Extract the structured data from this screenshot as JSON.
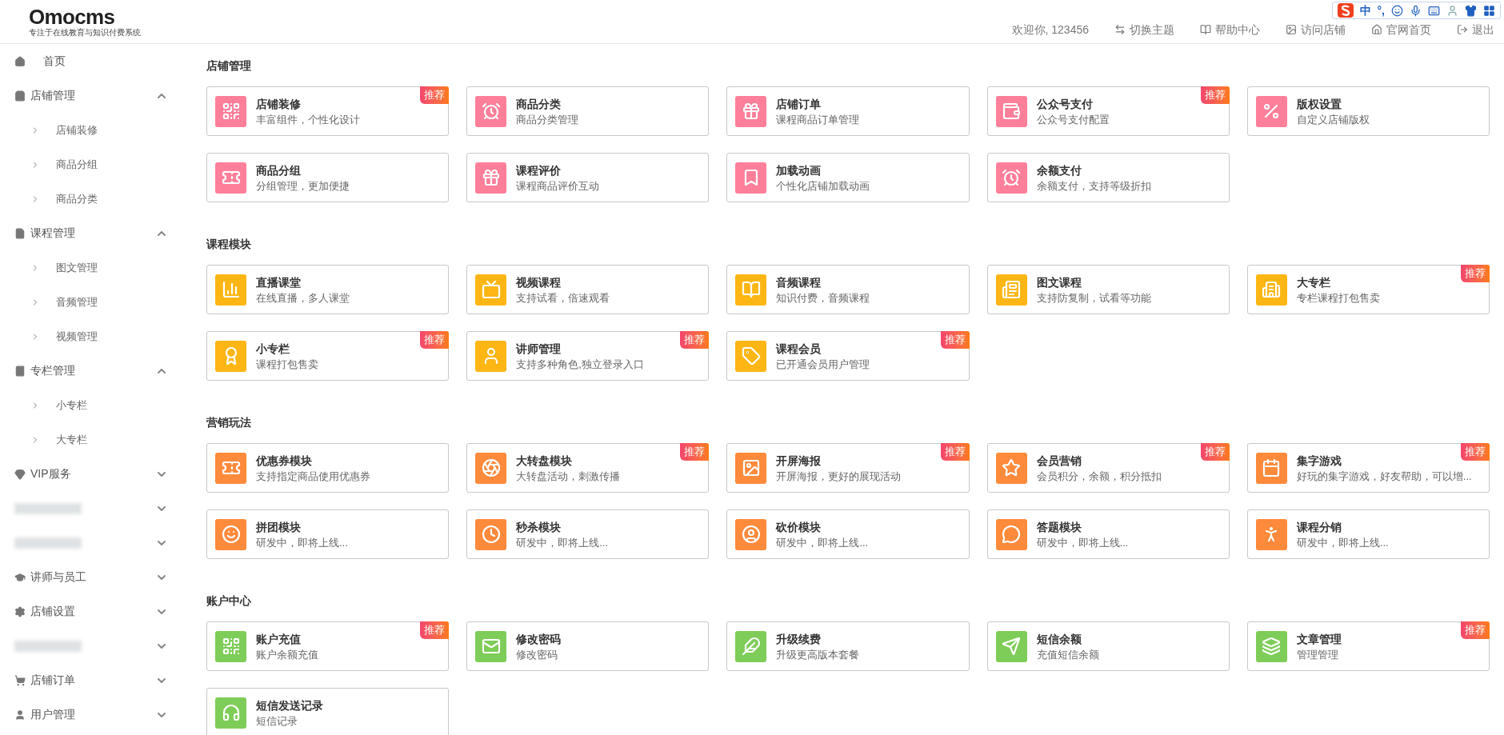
{
  "header": {
    "logo": "Omocms",
    "tagline": "专注于在线教育与知识付费系统",
    "welcome": "欢迎你, 123456",
    "links": [
      {
        "label": "切换主题"
      },
      {
        "label": "帮助中心"
      },
      {
        "label": "访问店铺"
      },
      {
        "label": "官网首页"
      },
      {
        "label": "退出"
      }
    ]
  },
  "ime_bar": {
    "mode": "中",
    "punct": "°,"
  },
  "sidebar": {
    "items": [
      {
        "kind": "link",
        "label": "首页"
      },
      {
        "kind": "group",
        "label": "店铺管理",
        "expanded": true,
        "children": [
          {
            "label": "店铺装修"
          },
          {
            "label": "商品分组"
          },
          {
            "label": "商品分类"
          }
        ]
      },
      {
        "kind": "group",
        "label": "课程管理",
        "expanded": true,
        "children": [
          {
            "label": "图文管理"
          },
          {
            "label": "音频管理"
          },
          {
            "label": "视频管理"
          }
        ]
      },
      {
        "kind": "group",
        "label": "专栏管理",
        "expanded": true,
        "children": [
          {
            "label": "小专栏"
          },
          {
            "label": "大专栏"
          }
        ]
      },
      {
        "kind": "group",
        "label": "VIP服务",
        "expanded": false
      },
      {
        "kind": "redacted",
        "expanded": false
      },
      {
        "kind": "redacted",
        "expanded": false
      },
      {
        "kind": "group",
        "label": "讲师与员工",
        "expanded": false
      },
      {
        "kind": "group",
        "label": "店铺设置",
        "expanded": false
      },
      {
        "kind": "redacted",
        "expanded": false
      },
      {
        "kind": "group",
        "label": "店铺订单",
        "expanded": false
      },
      {
        "kind": "group",
        "label": "用户管理",
        "expanded": false
      }
    ]
  },
  "sections": [
    {
      "title": "店铺管理",
      "color": "#fe7f9a",
      "cards": [
        {
          "title": "店铺装修",
          "desc": "丰富组件，个性化设计",
          "badge": "推荐"
        },
        {
          "title": "商品分类",
          "desc": "商品分类管理"
        },
        {
          "title": "店铺订单",
          "desc": "课程商品订单管理"
        },
        {
          "title": "公众号支付",
          "desc": "公众号支付配置",
          "badge": "推荐"
        },
        {
          "title": "版权设置",
          "desc": "自定义店铺版权"
        },
        {
          "title": "商品分组",
          "desc": "分组管理，更加便捷"
        },
        {
          "title": "课程评价",
          "desc": "课程商品评价互动"
        },
        {
          "title": "加载动画",
          "desc": "个性化店铺加载动画"
        },
        {
          "title": "余额支付",
          "desc": "余额支付，支持等级折扣"
        }
      ]
    },
    {
      "title": "课程模块",
      "color": "#fdb614",
      "cards": [
        {
          "title": "直播课堂",
          "desc": "在线直播，多人课堂"
        },
        {
          "title": "视频课程",
          "desc": "支持试看，倍速观看"
        },
        {
          "title": "音频课程",
          "desc": "知识付费，音频课程"
        },
        {
          "title": "图文课程",
          "desc": "支持防复制，试看等功能"
        },
        {
          "title": "大专栏",
          "desc": "专栏课程打包售卖",
          "badge": "推荐"
        },
        {
          "title": "小专栏",
          "desc": "课程打包售卖",
          "badge": "推荐"
        },
        {
          "title": "讲师管理",
          "desc": "支持多种角色,独立登录入口",
          "badge": "推荐"
        },
        {
          "title": "课程会员",
          "desc": "已开通会员用户管理",
          "badge": "推荐"
        }
      ]
    },
    {
      "title": "营销玩法",
      "color": "#fe8a3c",
      "cards": [
        {
          "title": "优惠券模块",
          "desc": "支持指定商品使用优惠券"
        },
        {
          "title": "大转盘模块",
          "desc": "大转盘活动，刺激传播",
          "badge": "推荐"
        },
        {
          "title": "开屏海报",
          "desc": "开屏海报，更好的展现活动",
          "badge": "推荐"
        },
        {
          "title": "会员营销",
          "desc": "会员积分，余额，积分抵扣",
          "badge": "推荐"
        },
        {
          "title": "集字游戏",
          "desc": "好玩的集字游戏，好友帮助，可以增...",
          "badge": "推荐"
        },
        {
          "title": "拼团模块",
          "desc": "研发中，即将上线..."
        },
        {
          "title": "秒杀模块",
          "desc": "研发中，即将上线..."
        },
        {
          "title": "砍价模块",
          "desc": "研发中，即将上线..."
        },
        {
          "title": "答题模块",
          "desc": "研发中，即将上线..."
        },
        {
          "title": "课程分销",
          "desc": "研发中，即将上线..."
        }
      ]
    },
    {
      "title": "账户中心",
      "color": "#7ecd58",
      "cards": [
        {
          "title": "账户充值",
          "desc": "账户余额充值",
          "badge": "推荐"
        },
        {
          "title": "修改密码",
          "desc": "修改密码"
        },
        {
          "title": "升级续费",
          "desc": "升级更高版本套餐"
        },
        {
          "title": "短信余额",
          "desc": "充值短信余额"
        },
        {
          "title": "文章管理",
          "desc": "管理管理",
          "badge": "推荐"
        },
        {
          "title": "短信发送记录",
          "desc": "短信记录"
        }
      ]
    }
  ]
}
